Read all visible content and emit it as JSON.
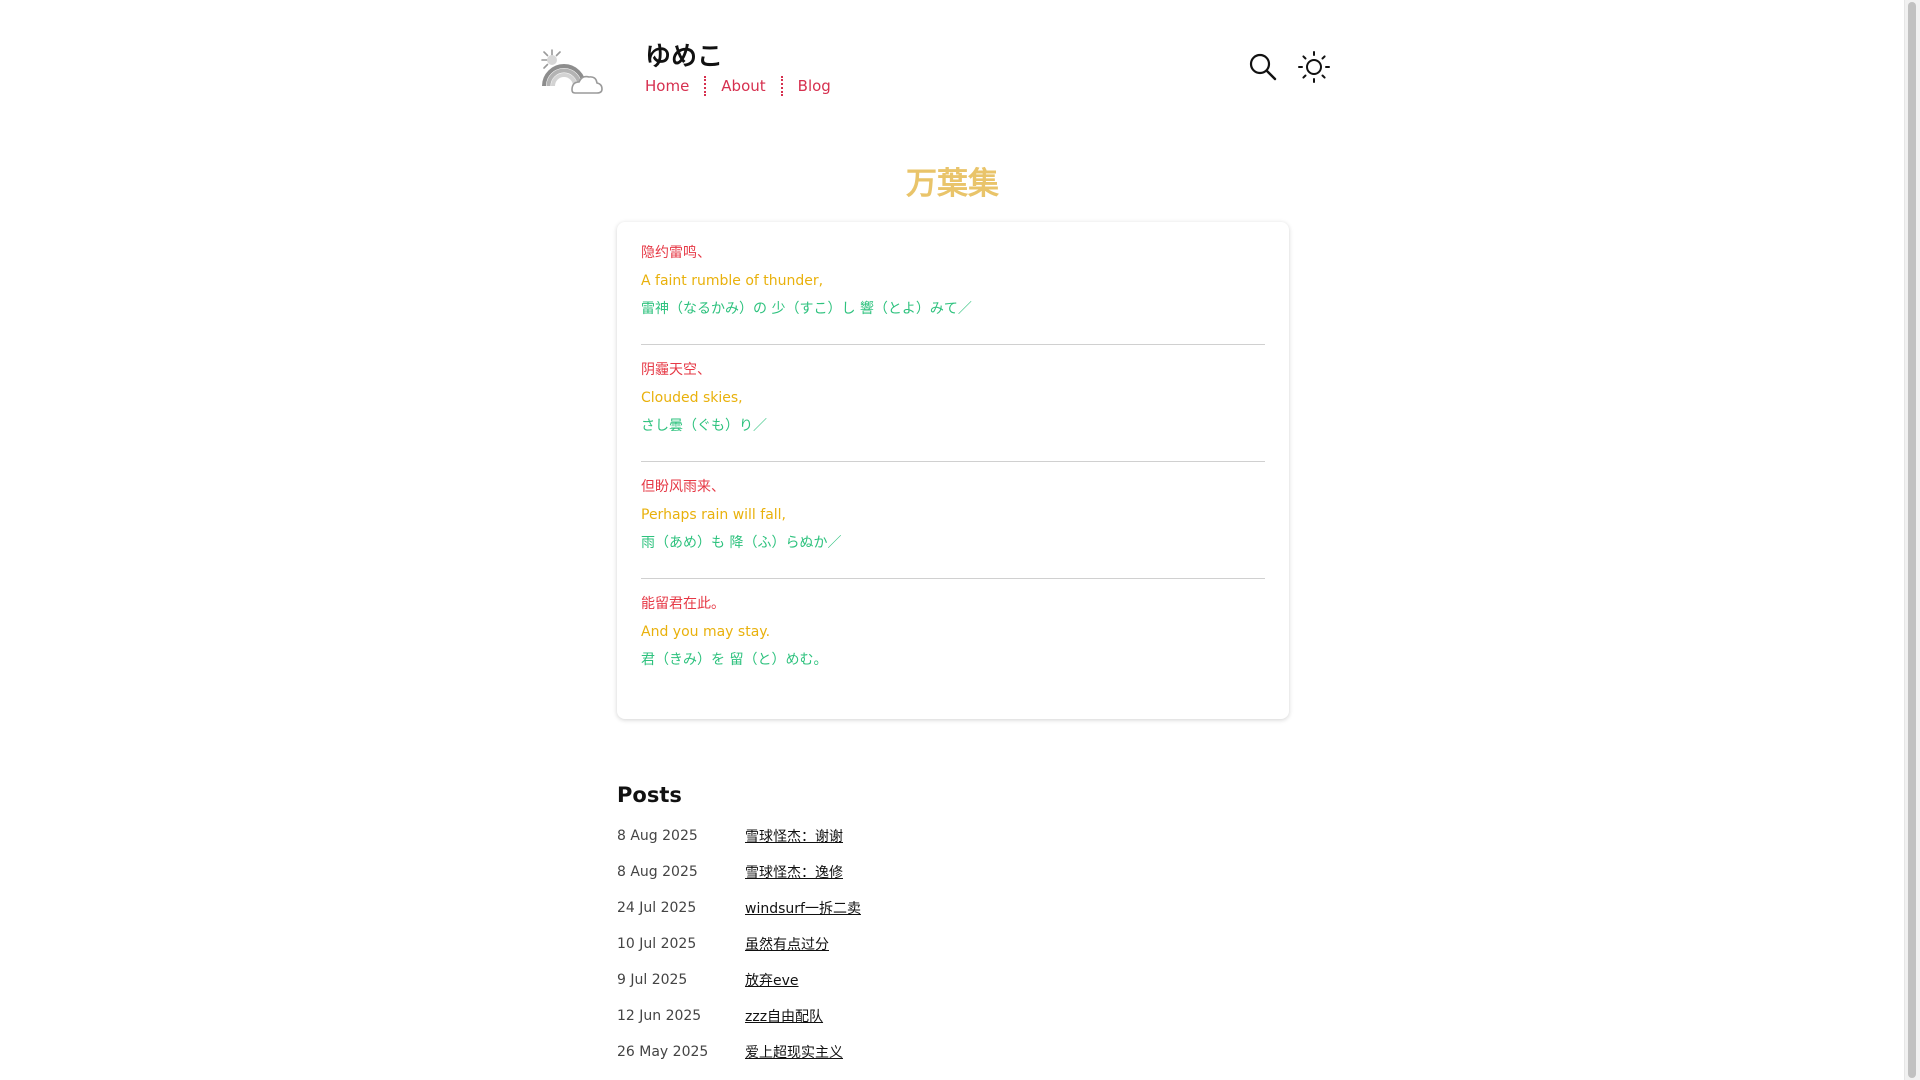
{
  "site": {
    "title": "ゆめこ",
    "logo_icon": "rainbow-cloud-icon"
  },
  "nav": [
    {
      "label": "Home"
    },
    {
      "label": "About"
    },
    {
      "label": "Blog"
    }
  ],
  "header_icons": {
    "search": "search-icon",
    "theme": "sun-icon"
  },
  "collection": {
    "title": "万葉集",
    "stanzas": [
      {
        "zh": "隐约雷鸣、",
        "en": "A faint rumble of thunder,",
        "jp": "雷神（なるかみ）の 少（すこ）し 響（とよ）みて／"
      },
      {
        "zh": "阴霾天空、",
        "en": "Clouded skies,",
        "jp": "さし曇（ぐも）り／"
      },
      {
        "zh": "但盼风雨来、",
        "en": "Perhaps rain will fall,",
        "jp": "雨（あめ）も 降（ふ）らぬか／"
      },
      {
        "zh": "能留君在此。",
        "en": "And you may stay.",
        "jp": "君（きみ）を 留（と）めむ。"
      }
    ]
  },
  "posts": {
    "heading": "Posts",
    "items": [
      {
        "date": "8 Aug 2025",
        "title": "雪球怪杰：谢谢"
      },
      {
        "date": "8 Aug 2025",
        "title": "雪球怪杰：逸修"
      },
      {
        "date": "24 Jul 2025",
        "title": "windsurf一拆二卖"
      },
      {
        "date": "10 Jul 2025",
        "title": "虽然有点过分"
      },
      {
        "date": "9 Jul 2025",
        "title": "放弃eve"
      },
      {
        "date": "12 Jun 2025",
        "title": "zzz自由配队"
      },
      {
        "date": "26 May 2025",
        "title": "爱上超现实主义"
      }
    ]
  },
  "colors": {
    "accent": "#d6304f",
    "title_gold": "#e9c46a",
    "line_red": "#e63946",
    "line_yellow": "#e9b10c",
    "line_green": "#2ec27e"
  }
}
